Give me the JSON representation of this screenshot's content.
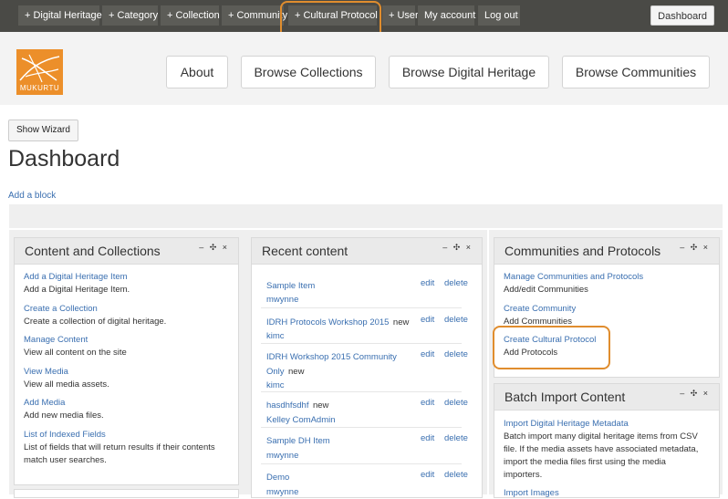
{
  "admin_bar": {
    "items": [
      "+ Digital Heritage",
      "+ Category",
      "+ Collection",
      "+ Community",
      "+ Cultural Protocol",
      "+ User",
      "My account",
      "Log out"
    ],
    "dashboard": "Dashboard"
  },
  "brand": {
    "logo_text": "MUKURTU"
  },
  "nav": {
    "items": [
      "About",
      "Browse Collections",
      "Browse Digital Heritage",
      "Browse Communities"
    ]
  },
  "page": {
    "show_wizard": "Show Wizard",
    "title": "Dashboard",
    "add_block": "Add a block"
  },
  "panels": {
    "content": {
      "title": "Content and Collections",
      "tools": "– ✣ ×",
      "items": [
        {
          "link": "Add a Digital Heritage Item",
          "desc": [
            "Add a Digital Heritage Item."
          ]
        },
        {
          "link": "Create a Collection",
          "desc": [
            "Create a collection of digital heritage."
          ]
        },
        {
          "link": "Manage Content",
          "desc": [
            "View all content on the site"
          ]
        },
        {
          "link": "View Media",
          "desc": [
            "View all media assets."
          ]
        },
        {
          "link": "Add Media",
          "desc": [
            "Add new media files."
          ]
        },
        {
          "link": "List of Indexed Fields",
          "desc": [
            "List of fields that will return results if their contents",
            "match user searches."
          ]
        }
      ]
    },
    "recent": {
      "title": "Recent content",
      "tools": "– ✣ ×",
      "edit_label": "edit",
      "delete_label": "delete",
      "new_label": "new",
      "rows": [
        {
          "title_lines": [
            "Sample Item"
          ],
          "is_new": false,
          "author": "mwynne"
        },
        {
          "title_lines": [
            "IDRH Protocols Workshop 2015"
          ],
          "is_new": true,
          "author": "kimc"
        },
        {
          "title_lines": [
            "IDRH Workshop 2015 Community",
            "Only"
          ],
          "is_new": true,
          "author": "kimc"
        },
        {
          "title_lines": [
            "hasdhfsdhf"
          ],
          "is_new": true,
          "author": "Kelley ComAdmin"
        },
        {
          "title_lines": [
            "Sample DH Item"
          ],
          "is_new": false,
          "author": "mwynne"
        },
        {
          "title_lines": [
            "Demo"
          ],
          "is_new": false,
          "author": "mwynne"
        }
      ]
    },
    "communities": {
      "title": "Communities and Protocols",
      "tools": "– ✣ ×",
      "items": [
        {
          "link": "Manage Communities and Protocols",
          "desc": "Add/edit Communities"
        },
        {
          "link": "Create Community",
          "desc": "Add Communities"
        },
        {
          "link": "Create Cultural Protocol",
          "desc": "Add Protocols"
        }
      ]
    },
    "batch": {
      "title": "Batch Import Content",
      "tools": "– ✣ ×",
      "link": "Import Digital Heritage Metadata",
      "desc": [
        "Batch import many digital heritage items from CSV",
        "file. If the media assets have associated metadata,",
        "import the media files first using the media",
        "importers."
      ],
      "link2": "Import Images"
    }
  },
  "colors": {
    "highlight": "#e08d2e",
    "link": "#3a6fb0",
    "logo": "#ec8f2a",
    "admin_bar": "#4a4a46"
  }
}
